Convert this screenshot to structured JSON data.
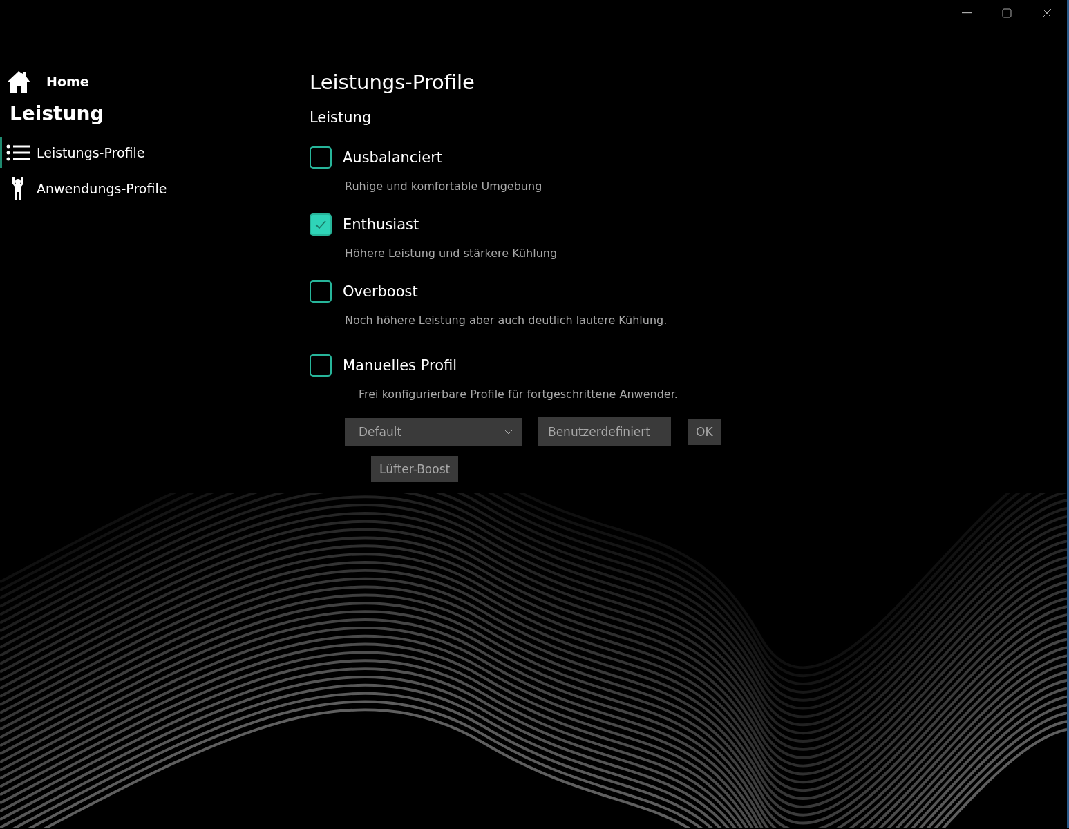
{
  "sidebar": {
    "home": "Home",
    "section": "Leistung",
    "items": [
      {
        "label": "Leistungs-Profile",
        "selected": true
      },
      {
        "label": "Anwendungs-Profile",
        "selected": false
      }
    ]
  },
  "page": {
    "title": "Leistungs-Profile",
    "subtitle": "Leistung",
    "options": [
      {
        "label": "Ausbalanciert",
        "description": "Ruhige und komfortable Umgebung",
        "checked": false
      },
      {
        "label": "Enthusiast",
        "description": "Höhere Leistung und stärkere Kühlung",
        "checked": true
      },
      {
        "label": "Overboost",
        "description": "Noch höhere Leistung aber auch deutlich lautere Kühlung.",
        "checked": false
      }
    ],
    "manual": {
      "label": "Manuelles Profil",
      "description": "Frei konfigurierbare Profile für fortgeschrittene Anwender.",
      "checked": false,
      "dropdown": "Default",
      "name_field": "Benutzerdefiniert",
      "ok": "OK",
      "fan_boost": "Lüfter-Boost"
    }
  }
}
